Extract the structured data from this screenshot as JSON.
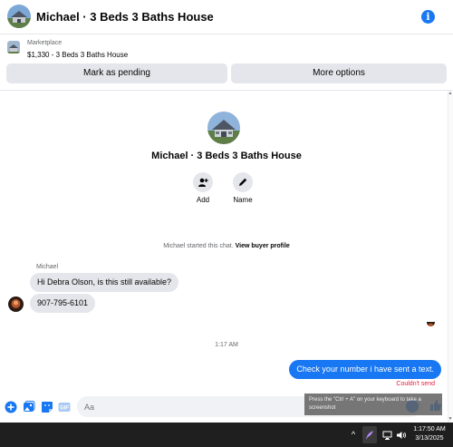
{
  "header": {
    "title": "Michael · 3 Beds 3 Baths House",
    "info_icon": "info-icon"
  },
  "marketplace": {
    "label": "Marketplace",
    "listing": "$1,330 - 3 Beds 3 Baths House",
    "pending_label": "Mark as pending",
    "more_label": "More options"
  },
  "profile": {
    "name": "Michael · 3 Beds 3 Baths House",
    "actions": [
      {
        "label": "Add",
        "icon": "add-person-icon"
      },
      {
        "label": "Name",
        "icon": "pencil-icon"
      }
    ]
  },
  "conversation": {
    "started_prefix": "Michael started this chat.",
    "started_link": "View buyer profile",
    "sender": "Michael",
    "messages_in": [
      "Hi Debra Olson, is this still available?",
      "907-795-6101"
    ],
    "timestamp": "1:17 AM",
    "message_out": "Check your number i have sent a text.",
    "fail_text": "Couldn't send"
  },
  "composer": {
    "placeholder": "Aa",
    "icons": [
      "plus-icon",
      "image-icon",
      "sticker-icon",
      "gif-icon",
      "emoji-icon",
      "like-icon"
    ],
    "gif_label": "GIF"
  },
  "tooltip": {
    "text": "Press the \"Ctrl + A\" on your keyboard to take a screenshot"
  },
  "taskbar": {
    "time": "1:17:50 AM",
    "date": "3/13/2025",
    "chevron": "^"
  },
  "colors": {
    "accent": "#1877f2",
    "bubble_in": "#e4e6eb",
    "error": "#e41e3f",
    "taskbar": "#1f1f1f"
  }
}
